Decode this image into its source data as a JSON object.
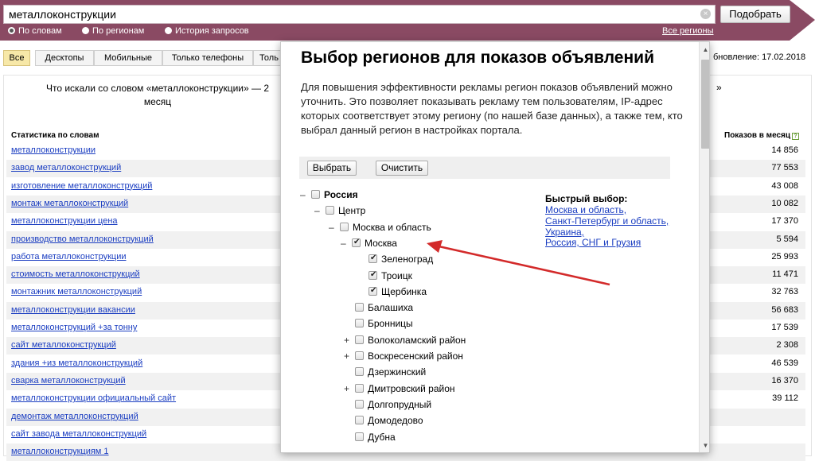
{
  "search": {
    "query": "металлоконструкции",
    "clear_symbol": "×",
    "submit_label": "Подобрать"
  },
  "modes": [
    {
      "label": "По словам",
      "selected": true
    },
    {
      "label": "По регионам",
      "selected": false
    },
    {
      "label": "История запросов",
      "selected": false
    }
  ],
  "all_regions_label": "Все регионы",
  "tabs": [
    {
      "label": "Все",
      "active": true
    },
    {
      "label": "Десктопы",
      "active": false
    },
    {
      "label": "Мобильные",
      "active": false
    },
    {
      "label": "Только телефоны",
      "active": false
    },
    {
      "label": "Толь",
      "active": false
    }
  ],
  "update_date": "бновление: 17.02.2018",
  "results": {
    "title": "Что искали со словом «металлоконструкции» — 2",
    "title_line2": "месяц",
    "title_right_fragment": "»",
    "col_words": "Статистика по словам",
    "col_shows": "Показов в месяц",
    "help_symbol": "?",
    "rows": [
      {
        "word": "металлоконструкции",
        "count": "14 856"
      },
      {
        "word": "завод металлоконструкций",
        "count": "77 553"
      },
      {
        "word": "изготовление металлоконструкций",
        "count": "43 008"
      },
      {
        "word": "монтаж металлоконструкций",
        "count": "10 082"
      },
      {
        "word": "металлоконструкции цена",
        "count": "17 370"
      },
      {
        "word": "производство металлоконструкций",
        "count": "5 594"
      },
      {
        "word": "работа металлоконструкции",
        "count": "25 993"
      },
      {
        "word": "стоимость металлоконструкций",
        "count": "11 471"
      },
      {
        "word": "монтажник металлоконструкций",
        "count": "32 763"
      },
      {
        "word": "металлоконструкции вакансии",
        "count": "56 683"
      },
      {
        "word": "металлоконструкций +за тонну",
        "count": "17 539"
      },
      {
        "word": "сайт металлоконструкций",
        "count": "2 308"
      },
      {
        "word": "здания +из металлоконструкций",
        "count": "46 539"
      },
      {
        "word": "сварка металлоконструкций",
        "count": "16 370"
      },
      {
        "word": "металлоконструкции официальный сайт",
        "count": "39 112"
      },
      {
        "word": "демонтаж металлоконструкций",
        "count": ""
      },
      {
        "word": "сайт завода металлоконструкций",
        "count": ""
      },
      {
        "word": "металлоконструкциям 1",
        "count": ""
      }
    ]
  },
  "modal": {
    "title": "Выбор регионов для показов объявлений",
    "description": "Для повышения эффективности рекламы регион показов объявлений можно уточнить. Это позволяет показывать рекламу тем пользователям, IP-адрес которых соответствует этому региону (по нашей базе данных), а также тем, кто выбрал данный регион в настройках портала.",
    "select_label": "Выбрать",
    "clear_label": "Очистить",
    "tree": [
      {
        "toggle": "–",
        "label": "Россия",
        "checked": false,
        "bold": true
      },
      {
        "toggle": "–",
        "label": "Центр",
        "checked": false
      },
      {
        "toggle": "–",
        "label": "Москва и область",
        "checked": false
      },
      {
        "toggle": "–",
        "label": "Москва",
        "checked": true
      },
      {
        "toggle": "",
        "label": "Зеленоград",
        "checked": true
      },
      {
        "toggle": "",
        "label": "Троицк",
        "checked": true
      },
      {
        "toggle": "",
        "label": "Щербинка",
        "checked": true
      },
      {
        "toggle": "",
        "label": "Балашиха",
        "checked": false
      },
      {
        "toggle": "",
        "label": "Бронницы",
        "checked": false
      },
      {
        "toggle": "+",
        "label": "Волоколамский район",
        "checked": false
      },
      {
        "toggle": "+",
        "label": "Воскресенский район",
        "checked": false
      },
      {
        "toggle": "",
        "label": "Дзержинский",
        "checked": false
      },
      {
        "toggle": "+",
        "label": "Дмитровский район",
        "checked": false
      },
      {
        "toggle": "",
        "label": "Долгопрудный",
        "checked": false
      },
      {
        "toggle": "",
        "label": "Домодедово",
        "checked": false
      },
      {
        "toggle": "",
        "label": "Дубна",
        "checked": false
      }
    ],
    "quick_title": "Быстрый выбор:",
    "quick_links": [
      "Москва и область,",
      "Санкт-Петербург и область,",
      "Украина,",
      "Россия, СНГ и Грузия"
    ],
    "scroll_up": "▲",
    "scroll_down": "▼"
  },
  "colors": {
    "header": "#8a4a63",
    "link": "#1a3dc1",
    "active_tab": "#f7e8a8",
    "annotation_arrow": "#d32a2a"
  }
}
